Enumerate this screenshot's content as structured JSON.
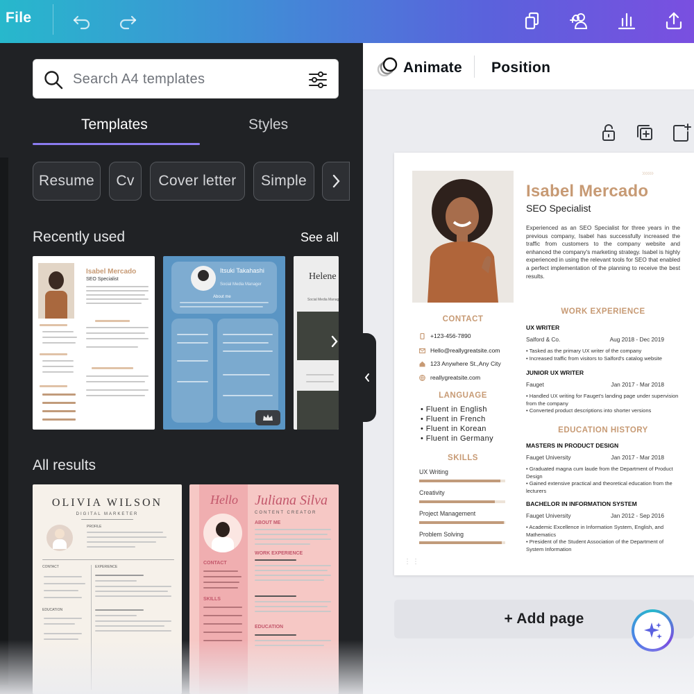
{
  "topbar": {
    "file_label": "File",
    "icons": [
      "undo-icon",
      "redo-icon",
      "duplicate-pages-icon",
      "add-people-icon",
      "insights-icon",
      "share-upload-icon"
    ]
  },
  "sidepanel": {
    "search_placeholder": "Search A4 templates",
    "tabs": [
      {
        "label": "Templates",
        "active": true
      },
      {
        "label": "Styles",
        "active": false
      }
    ],
    "chips": [
      "Resume",
      "Cv",
      "Cover letter",
      "Simple"
    ],
    "recently_used": {
      "title": "Recently used",
      "see_all": "See all",
      "items": [
        {
          "name": "Isabel Mercado",
          "role": "SEO Specialist"
        },
        {
          "name": "Itsuki Takahashi",
          "role": "Social Media Manager",
          "section": "About me"
        },
        {
          "name": "Helene Paquet",
          "role": "Social Media Manager"
        }
      ]
    },
    "all_results": {
      "title": "All results",
      "items": [
        {
          "name": "OLIVIA WILSON",
          "role": "DIGITAL MARKETER",
          "sections": [
            "PROFILE",
            "CONTACT",
            "EXPERIENCE",
            "EDUCATION"
          ]
        },
        {
          "script": "Hello",
          "name": "Juliana Silva",
          "role": "CONTENT CREATOR",
          "sections": [
            "ABOUT ME",
            "WORK EXPERIENCE",
            "CONTACT",
            "SKILLS",
            "EDUCATION"
          ]
        }
      ]
    }
  },
  "editor": {
    "animate_label": "Animate",
    "position_label": "Position",
    "page_tools": [
      "lock-icon",
      "duplicate-page-icon",
      "add-page-icon"
    ],
    "add_page_label": "+ Add page"
  },
  "resume": {
    "name": "Isabel Mercado",
    "title": "SEO Specialist",
    "summary": "Experienced as an SEO Specialist for three years in the previous company, Isabel has successfully increased the traffic from customers to the company website and enhanced the company's marketing strategy. Isabel is highly experienced in using the relevant tools for SEO that enabled a perfect implementation of the planning to receive the best results.",
    "contact_heading": "CONTACT",
    "contact": [
      {
        "icon": "phone-icon",
        "text": "+123-456-7890"
      },
      {
        "icon": "email-icon",
        "text": "Hello@reallygreatsite.com"
      },
      {
        "icon": "home-icon",
        "text": "123 Anywhere St.,Any City"
      },
      {
        "icon": "globe-icon",
        "text": "reallygreatsite.com"
      }
    ],
    "language_heading": "LANGUAGE",
    "languages": [
      "• Fluent in English",
      "• Fluent in French",
      "• Fluent in Korean",
      "• Fluent in Germany"
    ],
    "skills_heading": "SKILLS",
    "skills": [
      {
        "name": "UX Writing",
        "level": 0.94
      },
      {
        "name": "Creativity",
        "level": 0.88
      },
      {
        "name": "Project Management",
        "level": 0.98
      },
      {
        "name": "Problem Solving",
        "level": 0.96
      }
    ],
    "work_heading": "WORK EXPERIENCE",
    "work": [
      {
        "role": "UX WRITER",
        "company": "Salford & Co.",
        "dates": "Aug 2018 - Dec 2019",
        "bullets": [
          "• Tasked as the primary UX writer of the company",
          "• Increased traffic from visitors to Salford's catalog website"
        ]
      },
      {
        "role": "JUNIOR UX WRITER",
        "company": "Fauget",
        "dates": "Jan 2017 - Mar 2018",
        "bullets": [
          "• Handled UX writing for Fauget's landing page under supervision from the company",
          "• Converted product descriptions into shorter versions"
        ]
      }
    ],
    "education_heading": "EDUCATION HISTORY",
    "education": [
      {
        "degree": "MASTERS IN PRODUCT DESIGN",
        "school": "Fauget University",
        "dates": "Jan 2017 - Mar 2018",
        "bullets": [
          "• Graduated magna cum laude from the Department of Product Design",
          "• Gained extensive practical and theoretical education from the lecturers"
        ]
      },
      {
        "degree": "BACHELOR IN INFORMATION SYSTEM",
        "school": "Fauget University",
        "dates": "Jan 2012 - Sep 2016",
        "bullets": [
          "• Academic Excellence in Information System, English, and Mathematics",
          "• President of the Student Association of the Department of System Information"
        ]
      }
    ]
  },
  "colors": {
    "accent": "#c79a74",
    "sidepanel_bg": "#202225",
    "tab_underline": "#8b7cf0"
  }
}
